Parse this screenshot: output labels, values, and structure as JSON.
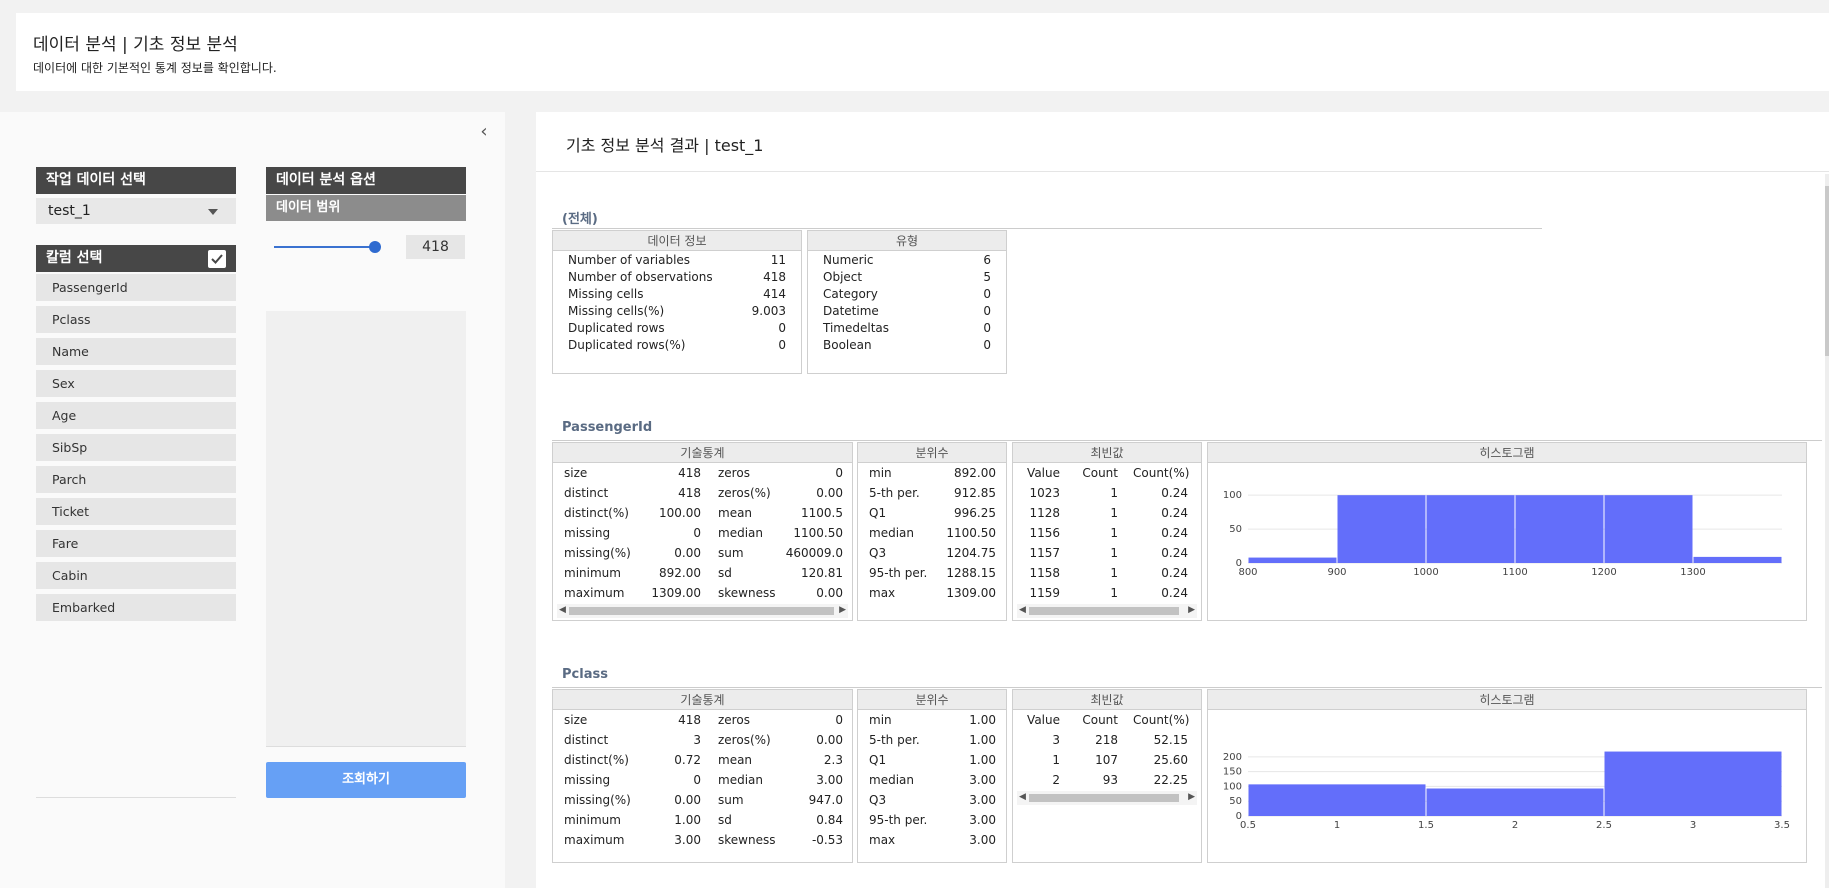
{
  "header": {
    "title": "데이터 분석 | 기초 정보 분석",
    "subtitle": "데이터에 대한 기본적인 통계 정보를 확인합니다."
  },
  "left": {
    "data_select_label": "작업 데이터 선택",
    "data_select_value": "test_1",
    "column_select_label": "칼럼 선택",
    "columns": [
      "PassengerId",
      "Pclass",
      "Name",
      "Sex",
      "Age",
      "SibSp",
      "Parch",
      "Ticket",
      "Fare",
      "Cabin",
      "Embarked"
    ],
    "options_label": "데이터 분석 옵션",
    "range_label": "데이터 범위",
    "range_value": "418",
    "range_fraction": 0.96,
    "query_button": "조회하기"
  },
  "result": {
    "title": "기초 정보 분석 결과 | test_1",
    "overall": {
      "label": "(전체)",
      "data_info_header": "데이터 정보",
      "data_info": [
        [
          "Number of variables",
          "11"
        ],
        [
          "Number of observations",
          "418"
        ],
        [
          "Missing cells",
          "414"
        ],
        [
          "Missing cells(%)",
          "9.003"
        ],
        [
          "Duplicated rows",
          "0"
        ],
        [
          "Duplicated rows(%)",
          "0"
        ]
      ],
      "type_header": "유형",
      "types": [
        [
          "Numeric",
          "6"
        ],
        [
          "Object",
          "5"
        ],
        [
          "Category",
          "0"
        ],
        [
          "Datetime",
          "0"
        ],
        [
          "Timedeltas",
          "0"
        ],
        [
          "Boolean",
          "0"
        ]
      ]
    },
    "passengerid": {
      "label": "PassengerId",
      "desc_header": "기술통계",
      "desc": [
        [
          "size",
          "418",
          "zeros",
          "0"
        ],
        [
          "distinct",
          "418",
          "zeros(%)",
          "0.00"
        ],
        [
          "distinct(%)",
          "100.00",
          "mean",
          "1100.5"
        ],
        [
          "missing",
          "0",
          "median",
          "1100.50"
        ],
        [
          "missing(%)",
          "0.00",
          "sum",
          "460009.0"
        ],
        [
          "minimum",
          "892.00",
          "sd",
          "120.81"
        ],
        [
          "maximum",
          "1309.00",
          "skewness",
          "0.00"
        ]
      ],
      "quant_header": "분위수",
      "quant": [
        [
          "min",
          "892.00"
        ],
        [
          "5-th per.",
          "912.85"
        ],
        [
          "Q1",
          "996.25"
        ],
        [
          "median",
          "1100.50"
        ],
        [
          "Q3",
          "1204.75"
        ],
        [
          "95-th per.",
          "1288.15"
        ],
        [
          "max",
          "1309.00"
        ]
      ],
      "mode_header": "최빈값",
      "mode_cols": [
        "Value",
        "Count",
        "Count(%)"
      ],
      "mode": [
        [
          "1023",
          "1",
          "0.24"
        ],
        [
          "1128",
          "1",
          "0.24"
        ],
        [
          "1156",
          "1",
          "0.24"
        ],
        [
          "1157",
          "1",
          "0.24"
        ],
        [
          "1158",
          "1",
          "0.24"
        ],
        [
          "1159",
          "1",
          "0.24"
        ]
      ],
      "hist_header": "히스토그램"
    },
    "pclass": {
      "label": "Pclass",
      "desc_header": "기술통계",
      "desc": [
        [
          "size",
          "418",
          "zeros",
          "0"
        ],
        [
          "distinct",
          "3",
          "zeros(%)",
          "0.00"
        ],
        [
          "distinct(%)",
          "0.72",
          "mean",
          "2.3"
        ],
        [
          "missing",
          "0",
          "median",
          "3.00"
        ],
        [
          "missing(%)",
          "0.00",
          "sum",
          "947.0"
        ],
        [
          "minimum",
          "1.00",
          "sd",
          "0.84"
        ],
        [
          "maximum",
          "3.00",
          "skewness",
          "-0.53"
        ]
      ],
      "quant_header": "분위수",
      "quant": [
        [
          "min",
          "1.00"
        ],
        [
          "5-th per.",
          "1.00"
        ],
        [
          "Q1",
          "1.00"
        ],
        [
          "median",
          "3.00"
        ],
        [
          "Q3",
          "3.00"
        ],
        [
          "95-th per.",
          "3.00"
        ],
        [
          "max",
          "3.00"
        ]
      ],
      "mode_header": "최빈값",
      "mode_cols": [
        "Value",
        "Count",
        "Count(%)"
      ],
      "mode": [
        [
          "3",
          "218",
          "52.15"
        ],
        [
          "1",
          "107",
          "25.60"
        ],
        [
          "2",
          "93",
          "22.25"
        ]
      ],
      "hist_header": "히스토그램"
    }
  },
  "chart_data": [
    {
      "type": "bar",
      "bin_edges": [
        800,
        900,
        1000,
        1100,
        1200,
        1300,
        1400
      ],
      "values": [
        8,
        100,
        100,
        100,
        100,
        9
      ],
      "xticks": [
        800,
        900,
        1000,
        1100,
        1200,
        1300
      ],
      "yticks": [
        0,
        50,
        100
      ],
      "ylim": [
        0,
        115
      ],
      "color": "#636efa"
    },
    {
      "type": "bar",
      "bin_edges": [
        0.5,
        1.5,
        2.5,
        3.5
      ],
      "values": [
        107,
        93,
        218
      ],
      "xticks": [
        0.5,
        1,
        1.5,
        2,
        2.5,
        3,
        3.5
      ],
      "yticks": [
        0,
        50,
        100,
        150,
        200
      ],
      "ylim": [
        0,
        230
      ],
      "color": "#636efa"
    }
  ]
}
